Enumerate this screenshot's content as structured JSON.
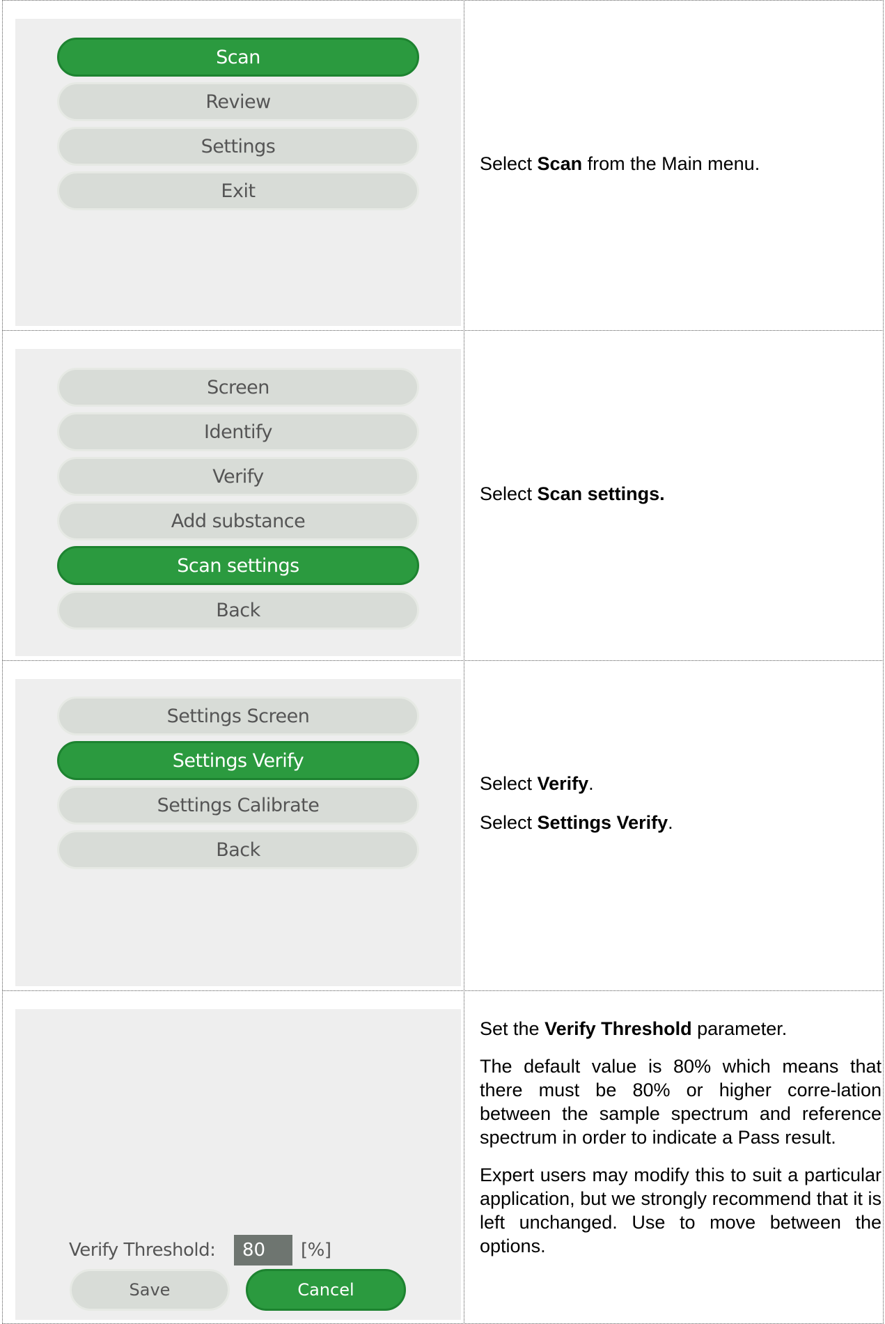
{
  "rows": [
    {
      "menu": [
        {
          "label": "Scan",
          "selected": true
        },
        {
          "label": "Review",
          "selected": false
        },
        {
          "label": "Settings",
          "selected": false
        },
        {
          "label": "Exit",
          "selected": false
        }
      ],
      "text": {
        "pre": "Select ",
        "bold": "Scan",
        "post": " from the Main menu."
      }
    },
    {
      "menu": [
        {
          "label": "Screen",
          "selected": false
        },
        {
          "label": "Identify",
          "selected": false
        },
        {
          "label": "Verify",
          "selected": false
        },
        {
          "label": "Add substance",
          "selected": false
        },
        {
          "label": "Scan settings",
          "selected": true
        },
        {
          "label": "Back",
          "selected": false
        }
      ],
      "text": {
        "pre": "Select ",
        "bold": "Scan settings.",
        "post": ""
      }
    },
    {
      "menu": [
        {
          "label": "Settings Screen",
          "selected": false
        },
        {
          "label": "Settings Verify",
          "selected": true
        },
        {
          "label": "Settings Calibrate",
          "selected": false
        },
        {
          "label": "Back",
          "selected": false
        }
      ],
      "text1": {
        "pre": "Select ",
        "bold": "Verify",
        "post": "."
      },
      "text2": {
        "pre": "Select ",
        "bold": "Settings Verify",
        "post": "."
      }
    },
    {
      "field": {
        "label": "Verify Threshold:",
        "value": "80",
        "unit": "[%]"
      },
      "buttons": {
        "save": "Save",
        "cancel": "Cancel"
      },
      "para1": {
        "pre": "Set the ",
        "bold": "Verify Threshold",
        "post": " parameter."
      },
      "para2": "The default value is 80% which means that there must be 80% or higher corre-lation between the sample spectrum and reference spectrum in order to indicate a Pass result.",
      "para3": "Expert users may modify this to suit a particular application, but we strongly recommend that it is left unchanged. Use to move between the options."
    }
  ],
  "colors": {
    "selected": "#2b9a3f",
    "unselected": "#d8dcd7",
    "screen_bg": "#eeeeee"
  }
}
